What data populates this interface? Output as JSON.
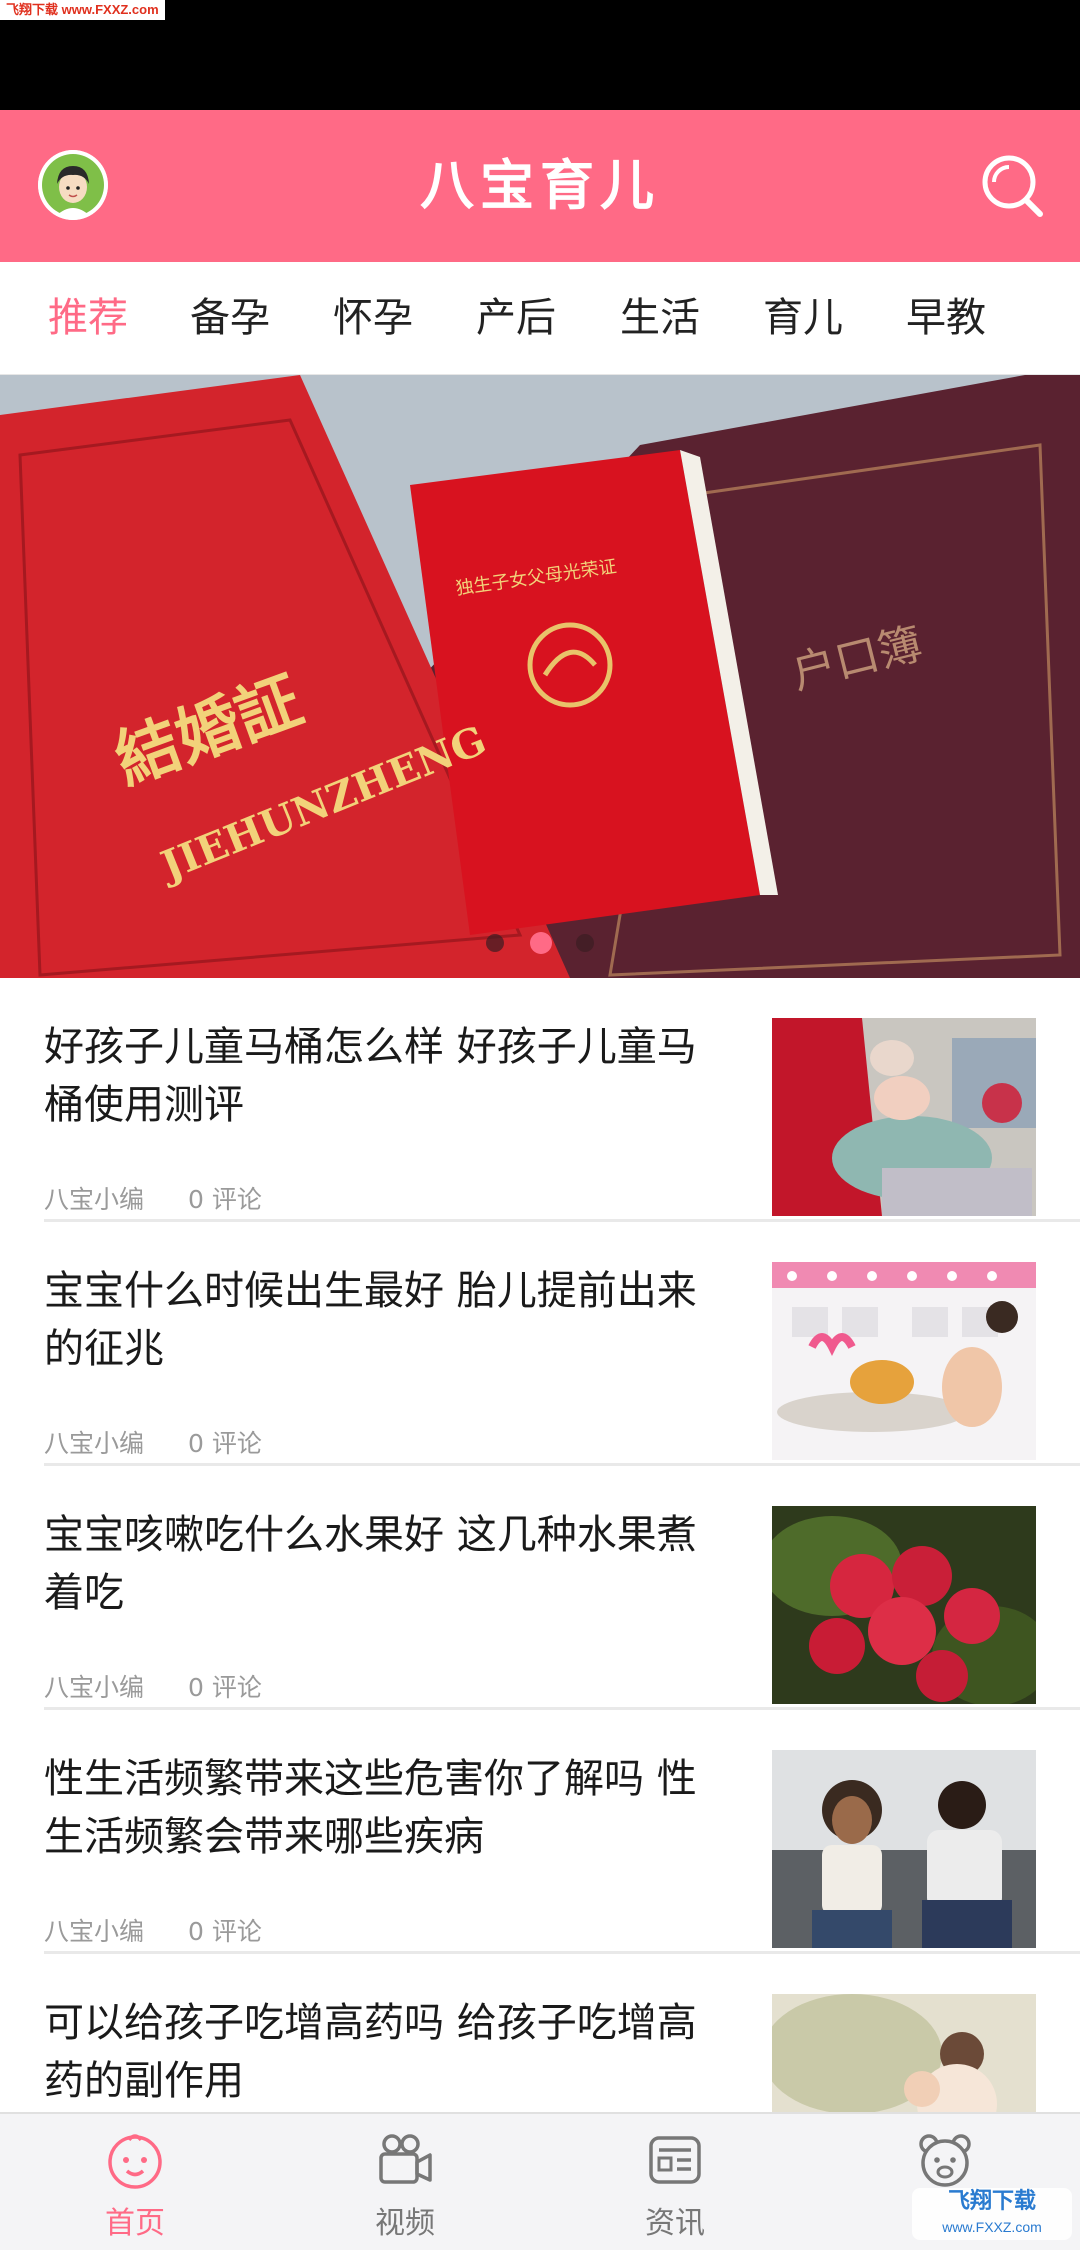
{
  "watermark": {
    "top_text": "飞翔下载 www.FXXZ.com",
    "corner_text": "飞翔下载",
    "corner_sub": "www.FXXZ.com"
  },
  "header": {
    "title": "八宝育儿"
  },
  "tabs": [
    {
      "label": "推荐",
      "active": true
    },
    {
      "label": "备孕"
    },
    {
      "label": "怀孕"
    },
    {
      "label": "产后"
    },
    {
      "label": "生活"
    },
    {
      "label": "育儿"
    },
    {
      "label": "早教"
    }
  ],
  "banner": {
    "image_text": {
      "cert": "結婚証",
      "cert_latin": "JIEHUNZHENG",
      "book": "独生子女父母光荣证",
      "hukou": "户口簿"
    },
    "slides": 3,
    "active_slide": 1
  },
  "articles": [
    {
      "title": "好孩子儿童马桶怎么样 好孩子儿童马桶使用测评",
      "author": "八宝小编",
      "comments": "0 评论"
    },
    {
      "title": "宝宝什么时候出生最好 胎儿提前出来的征兆",
      "author": "八宝小编",
      "comments": "0 评论"
    },
    {
      "title": "宝宝咳嗽吃什么水果好 这几种水果煮着吃",
      "author": "八宝小编",
      "comments": "0 评论"
    },
    {
      "title": "性生活频繁带来这些危害你了解吗 性生活频繁会带来哪些疾病",
      "author": "八宝小编",
      "comments": "0 评论"
    },
    {
      "title": "可以给孩子吃增高药吗 给孩子吃增高药的副作用",
      "author": "",
      "comments": ""
    }
  ],
  "bottom_nav": [
    {
      "label": "首页",
      "icon": "baby-face-icon",
      "active": true
    },
    {
      "label": "视频",
      "icon": "video-camera-icon"
    },
    {
      "label": "资讯",
      "icon": "news-icon"
    },
    {
      "label": "",
      "icon": "bear-icon"
    }
  ],
  "colors": {
    "accent": "#ff6a86",
    "statusbar": "#000000",
    "nav_bg": "#f4f4f6"
  }
}
